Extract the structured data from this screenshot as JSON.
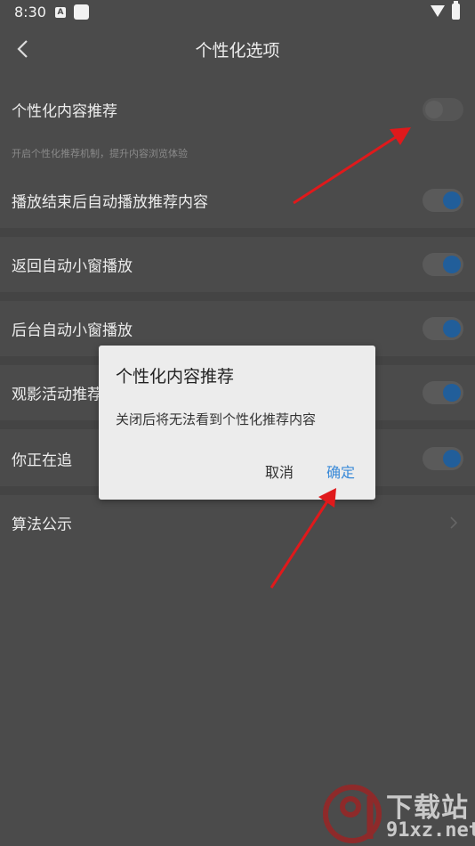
{
  "status_bar": {
    "time": "8:30",
    "notif_letter": "A"
  },
  "nav": {
    "title": "个性化选项"
  },
  "settings": [
    {
      "label": "个性化内容推荐",
      "state": "off"
    },
    {
      "label": "播放结束后自动播放推荐内容",
      "state": "on"
    },
    {
      "label": "返回自动小窗播放",
      "state": "on"
    },
    {
      "label": "后台自动小窗播放",
      "state": "on"
    },
    {
      "label": "观影活动推荐",
      "state": "on"
    },
    {
      "label": "你正在追",
      "state": "on"
    },
    {
      "label": "算法公示"
    }
  ],
  "hint": "开启个性化推荐机制，提升内容浏览体验",
  "dialog": {
    "title": "个性化内容推荐",
    "message": "关闭后将无法看到个性化推荐内容",
    "cancel": "取消",
    "confirm": "确定"
  },
  "watermark": {
    "text": "下载站",
    "url": "91xz.net"
  },
  "colors": {
    "toggle_on": "#215e9a",
    "confirm": "#3a8ad8",
    "arrow": "#e0191b"
  }
}
